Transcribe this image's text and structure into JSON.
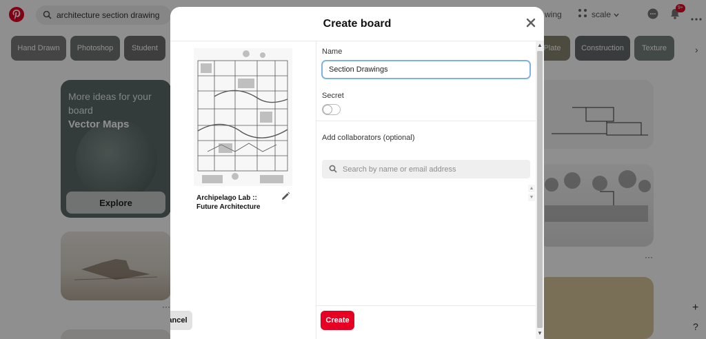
{
  "background": {
    "search": {
      "query": "architecture section drawing"
    },
    "header_right": {
      "partial_chip_1": "wing",
      "partial_chip_2": "scale",
      "notification_count": "9+"
    },
    "chips": [
      "Hand Drawn",
      "Photoshop",
      "Student",
      "Plate",
      "Construction",
      "Texture"
    ],
    "idea_card": {
      "heading": "More ideas for your board",
      "name": "Vector Maps",
      "button": "Explore"
    }
  },
  "modal": {
    "title": "Create board",
    "pin": {
      "title": "Archipelago Lab :: Future Architecture"
    },
    "name_field": {
      "label": "Name",
      "value": "Section Drawings"
    },
    "secret": {
      "label": "Secret",
      "enabled": false
    },
    "collaborators": {
      "label": "Add collaborators (optional)",
      "placeholder": "Search by name or email address"
    },
    "actions": {
      "cancel": "Cancel",
      "create": "Create"
    }
  },
  "colors": {
    "accent": "#e60023",
    "focus_ring": "#7fb1e3",
    "overlay": "rgba(0,0,0,0.44)"
  },
  "icons": [
    "pinterest-logo-icon",
    "search-icon",
    "chat-icon",
    "bell-icon",
    "more-icon",
    "close-icon",
    "pencil-icon",
    "chevron-right-icon",
    "plus-icon",
    "help-icon"
  ]
}
